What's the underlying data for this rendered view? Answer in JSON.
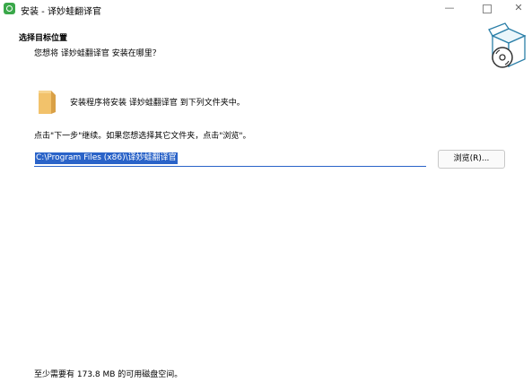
{
  "window": {
    "title": "安装 - 译妙蛙翻译官"
  },
  "header": {
    "title": "选择目标位置",
    "subtitle": "您想将 译妙蛙翻译官 安装在哪里？"
  },
  "body": {
    "info_text": "安装程序将安装 译妙蛙翻译官 到下列文件夹中。",
    "hint_text": "点击\"下一步\"继续。如果您想选择其它文件夹，点击\"浏览\"。",
    "path_value": "C:\\Program Files (x86)\\译妙蛙翻译官",
    "browse_label": "浏览(R)...",
    "space_text": "至少需要有 173.8 MB 的可用磁盘空间。"
  },
  "colors": {
    "selection": "#2a63c8",
    "app_icon": "#3aa84a",
    "folder": "#f2c26b"
  },
  "icons": [
    "app-logo-icon",
    "minimize-icon",
    "maximize-icon",
    "close-icon",
    "installer-box-icon",
    "folder-icon"
  ]
}
